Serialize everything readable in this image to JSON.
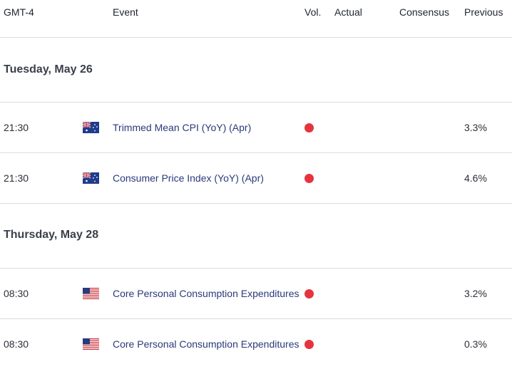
{
  "header": {
    "timezone": "GMT-4",
    "event": "Event",
    "vol": "Vol.",
    "actual": "Actual",
    "consensus": "Consensus",
    "previous": "Previous"
  },
  "colors": {
    "volatility_high": "#e5343f",
    "event_text": "#2a3a78",
    "divider": "#dcdcdc"
  },
  "groups": [
    {
      "date": "Tuesday, May 26",
      "events": [
        {
          "time": "21:30",
          "flag": "australia-flag-icon",
          "event": "Trimmed Mean CPI (YoY) (Apr)",
          "volatility": "high",
          "actual": "",
          "consensus": "",
          "previous": "3.3%"
        },
        {
          "time": "21:30",
          "flag": "australia-flag-icon",
          "event": "Consumer Price Index (YoY) (Apr)",
          "volatility": "high",
          "actual": "",
          "consensus": "",
          "previous": "4.6%"
        }
      ]
    },
    {
      "date": "Thursday, May 28",
      "events": [
        {
          "time": "08:30",
          "flag": "us-flag-icon",
          "event": "Core Personal Consumption Expenditures",
          "volatility": "high",
          "actual": "",
          "consensus": "",
          "previous": "3.2%"
        },
        {
          "time": "08:30",
          "flag": "us-flag-icon",
          "event": "Core Personal Consumption Expenditures",
          "volatility": "high",
          "actual": "",
          "consensus": "",
          "previous": "0.3%"
        }
      ]
    }
  ]
}
